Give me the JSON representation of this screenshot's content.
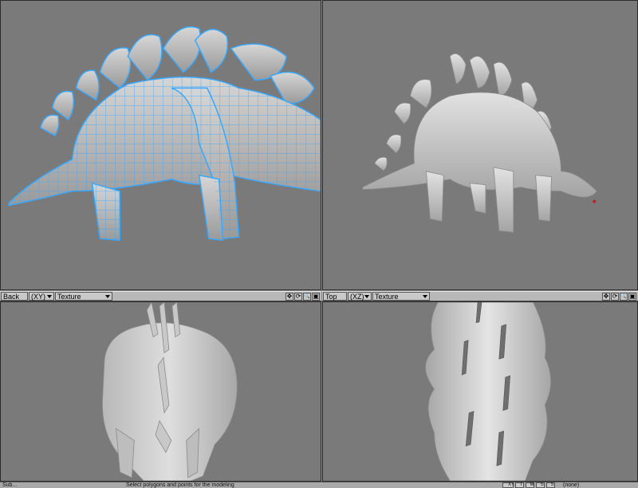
{
  "viewports": {
    "back": {
      "view_label": "Back",
      "axis_label": "(XY)",
      "shading_label": "Texture"
    },
    "top": {
      "view_label": "Top",
      "axis_label": "(XZ)",
      "shading_label": "Texture"
    }
  },
  "viewport_tools": {
    "move_icon": "✥",
    "rotate_icon": "⟳",
    "zoom_icon": "🔍",
    "maximize_icon": "▣"
  },
  "status_bar": {
    "left_text": "Sub...",
    "center_text": "Select polygons and points for the modeling",
    "buttons": [
      "XY",
      "T",
      "M",
      "S",
      "S"
    ],
    "right_text": "(none)"
  },
  "colors": {
    "wireframe": "#3aa7ff",
    "viewport_bg": "#7a7a7a",
    "model": "#d8d8d8"
  }
}
